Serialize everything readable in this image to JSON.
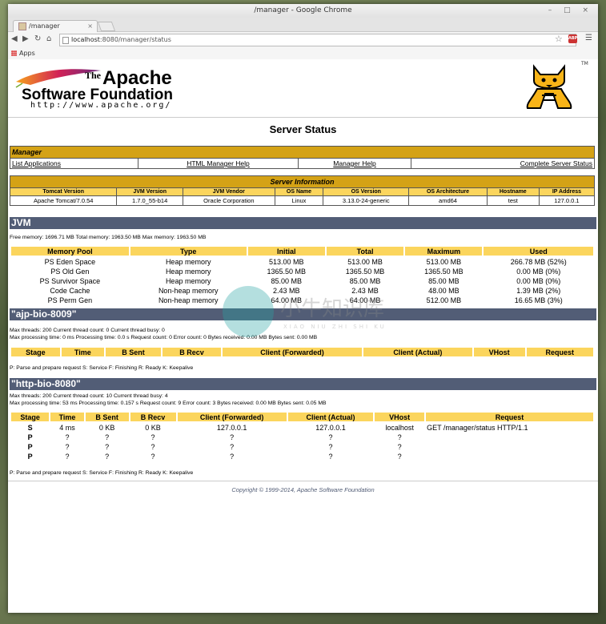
{
  "window": {
    "title": "/manager - Google Chrome",
    "controls": "– □ ×"
  },
  "tab": {
    "label": "/manager",
    "close": "×"
  },
  "address": {
    "host": "localhost",
    "rest": ":8080/manager/status"
  },
  "bookmarks": {
    "apps": "Apps"
  },
  "logo": {
    "the": "The",
    "apache": "Apache",
    "sf": "Software Foundation",
    "url": "http://www.apache.org/",
    "tm": "TM",
    "abp": "ABP"
  },
  "page_title": "Server Status",
  "manager": {
    "header": "Manager",
    "links": [
      "List Applications",
      "HTML Manager Help",
      "Manager Help",
      "Complete Server Status"
    ]
  },
  "server_info": {
    "header": "Server Information",
    "columns": [
      "Tomcat Version",
      "JVM Version",
      "JVM Vendor",
      "OS Name",
      "OS Version",
      "OS Architecture",
      "Hostname",
      "IP Address"
    ],
    "values": [
      "Apache Tomcat/7.0.54",
      "1.7.0_55-b14",
      "Oracle Corporation",
      "Linux",
      "3.13.0-24-generic",
      "amd64",
      "test",
      "127.0.0.1"
    ]
  },
  "jvm": {
    "title": "JVM",
    "memory": "Free memory: 1696.71 MB Total memory: 1963.50 MB Max memory: 1963.50 MB",
    "columns": [
      "Memory Pool",
      "Type",
      "Initial",
      "Total",
      "Maximum",
      "Used"
    ],
    "rows": [
      [
        "PS Eden Space",
        "Heap memory",
        "513.00 MB",
        "513.00 MB",
        "513.00 MB",
        "266.78 MB (52%)"
      ],
      [
        "PS Old Gen",
        "Heap memory",
        "1365.50 MB",
        "1365.50 MB",
        "1365.50 MB",
        "0.00 MB (0%)"
      ],
      [
        "PS Survivor Space",
        "Heap memory",
        "85.00 MB",
        "85.00 MB",
        "85.00 MB",
        "0.00 MB (0%)"
      ],
      [
        "Code Cache",
        "Non-heap memory",
        "2.43 MB",
        "2.43 MB",
        "48.00 MB",
        "1.39 MB (2%)"
      ],
      [
        "PS Perm Gen",
        "Non-heap memory",
        "64.00 MB",
        "64.00 MB",
        "512.00 MB",
        "16.65 MB (3%)"
      ]
    ]
  },
  "ajp": {
    "title": "\"ajp-bio-8009\"",
    "line1": "Max threads: 200 Current thread count: 0 Current thread busy: 0",
    "line2": "Max processing time: 0 ms Processing time: 0.0 s Request count: 0 Error count: 0 Bytes received: 0.00 MB Bytes sent: 0.00 MB",
    "columns": [
      "Stage",
      "Time",
      "B Sent",
      "B Recv",
      "Client (Forwarded)",
      "Client (Actual)",
      "VHost",
      "Request"
    ],
    "legend": "P: Parse and prepare request S: Service F: Finishing R: Ready K: Keepalive"
  },
  "http": {
    "title": "\"http-bio-8080\"",
    "line1": "Max threads: 200 Current thread count: 10 Current thread busy: 4",
    "line2": "Max processing time: 53 ms Processing time: 0.157 s Request count: 9 Error count: 3 Bytes received: 0.00 MB Bytes sent: 0.05 MB",
    "columns": [
      "Stage",
      "Time",
      "B Sent",
      "B Recv",
      "Client (Forwarded)",
      "Client (Actual)",
      "VHost",
      "Request"
    ],
    "rows": [
      [
        "S",
        "4 ms",
        "0 KB",
        "0 KB",
        "127.0.0.1",
        "127.0.0.1",
        "localhost",
        "GET /manager/status HTTP/1.1"
      ],
      [
        "P",
        "?",
        "?",
        "?",
        "?",
        "?",
        "?",
        ""
      ],
      [
        "P",
        "?",
        "?",
        "?",
        "?",
        "?",
        "?",
        ""
      ],
      [
        "P",
        "?",
        "?",
        "?",
        "?",
        "?",
        "?",
        ""
      ]
    ],
    "legend": "P: Parse and prepare request S: Service F: Finishing R: Ready K: Keepalive"
  },
  "footer": "Copyright © 1999-2014, Apache Software Foundation",
  "watermark": {
    "cn": "小牛知识库",
    "pinyin": "XIAO NIU ZHI SHI KU"
  }
}
